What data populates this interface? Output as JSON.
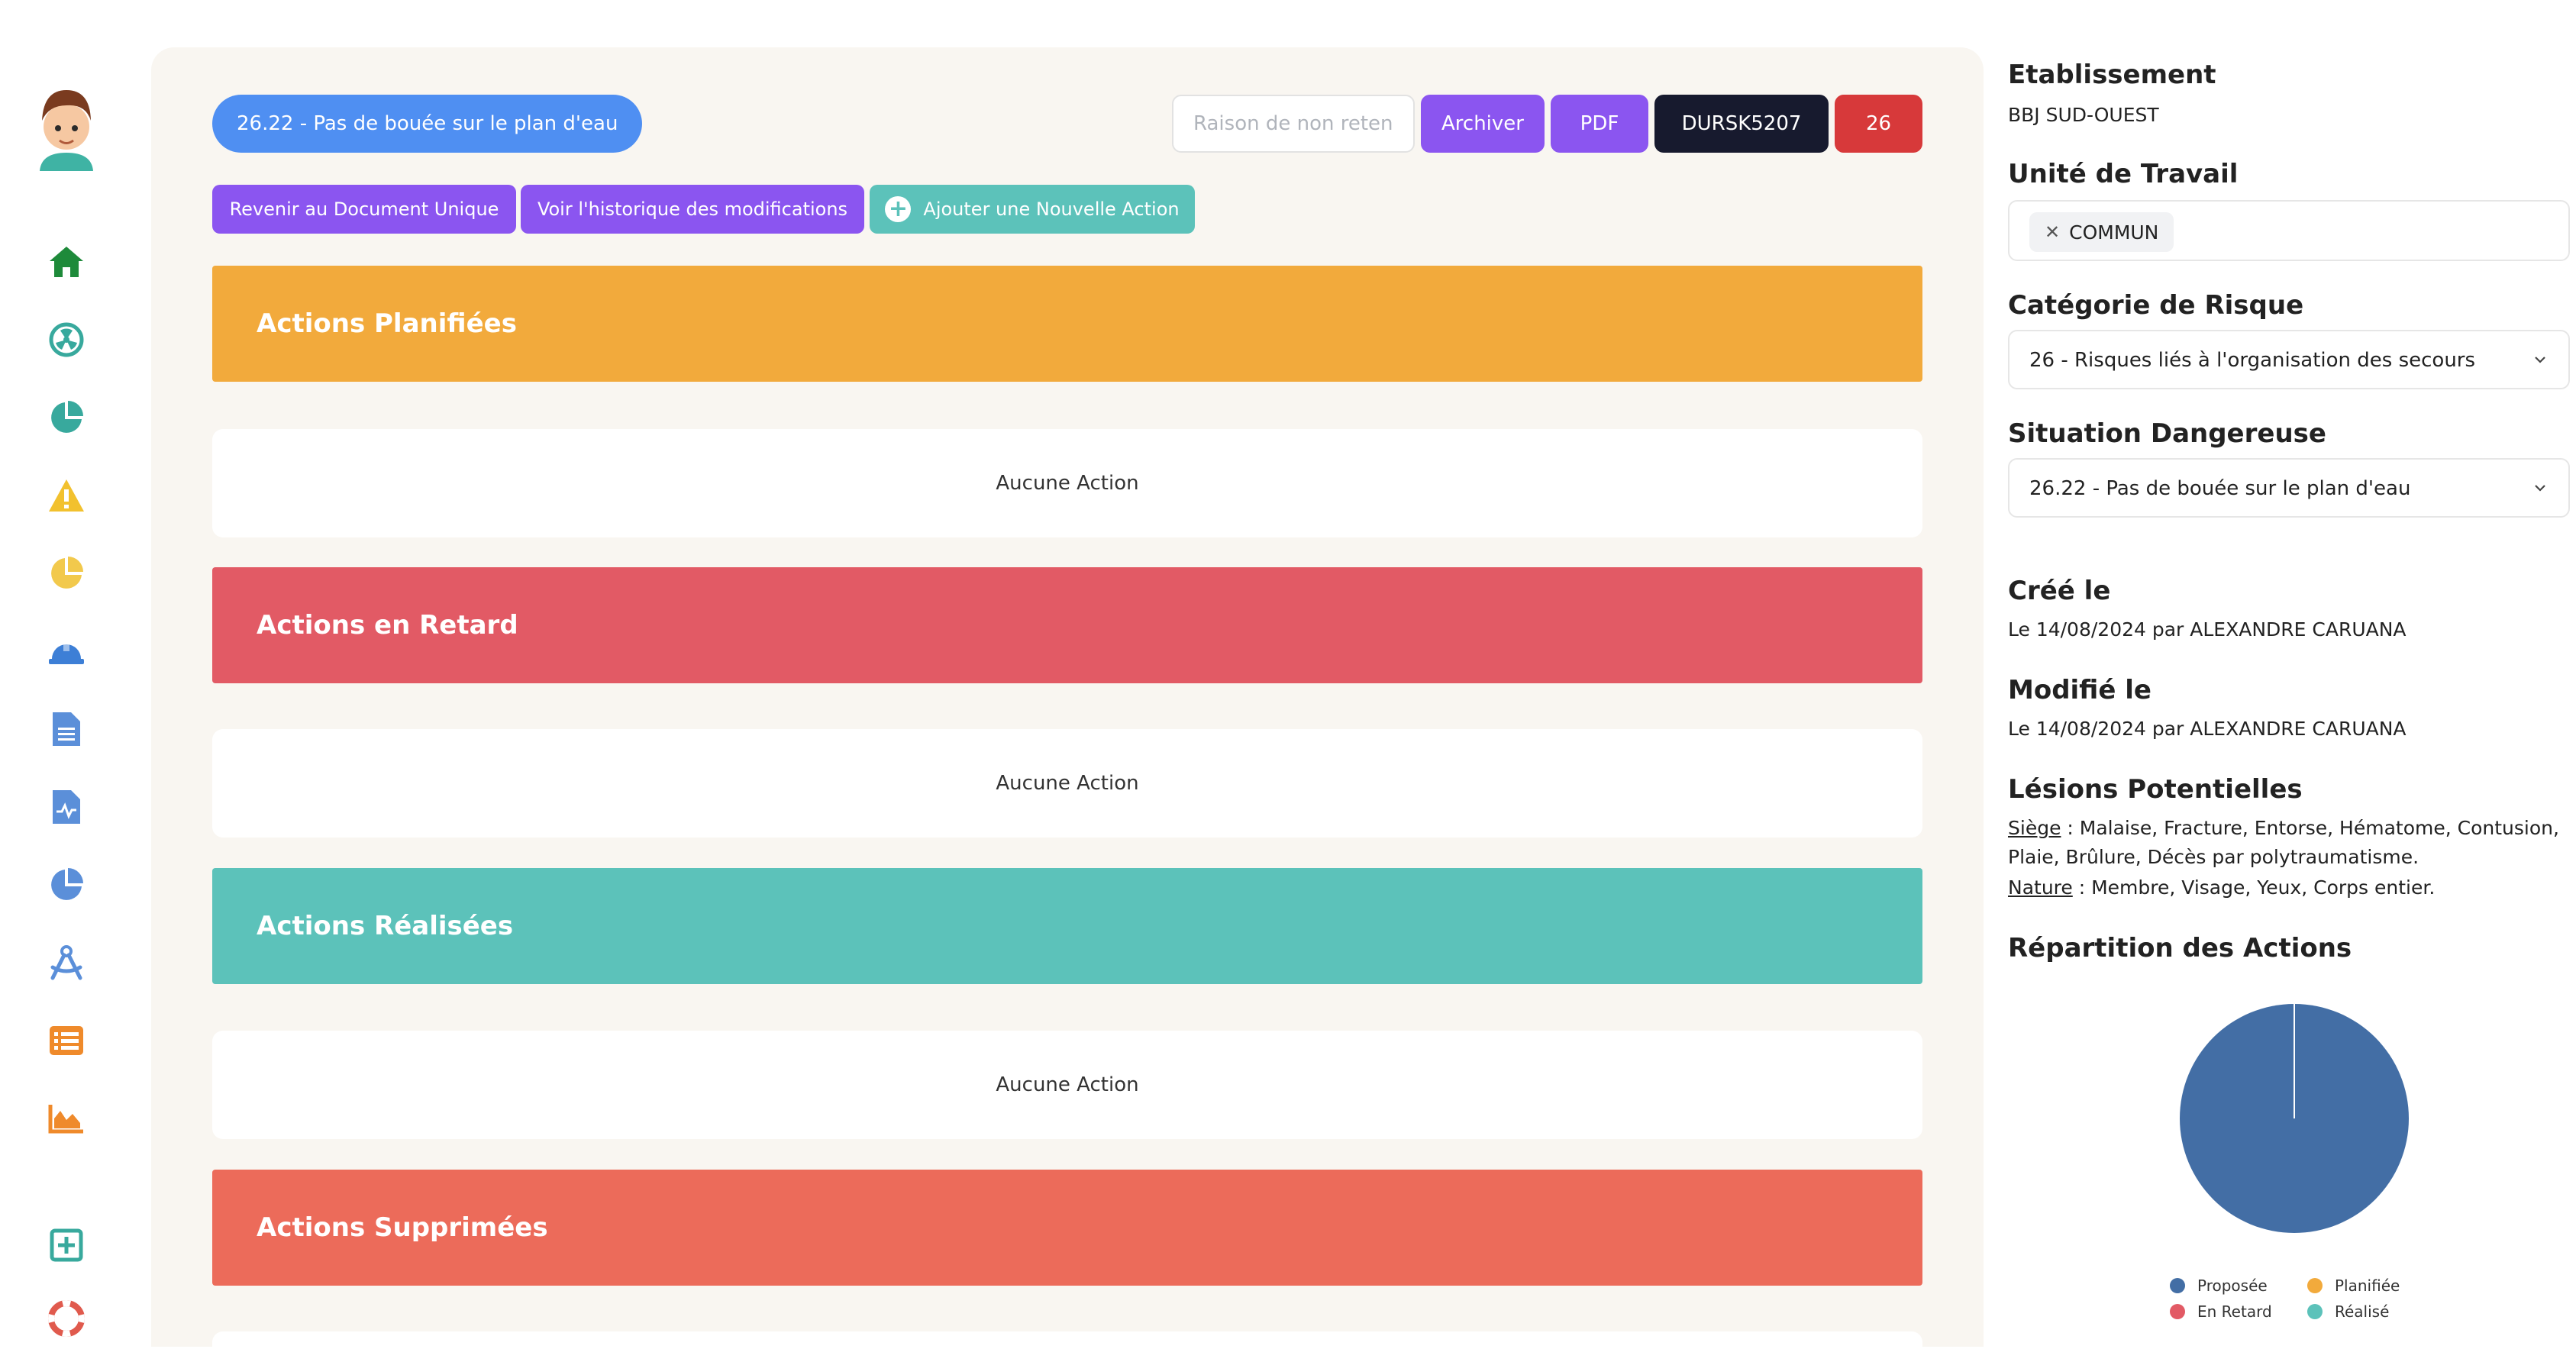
{
  "sidebar": {
    "icons": [
      "home-icon",
      "radiation-icon",
      "pie-chart-icon",
      "warning-icon",
      "pie-chart-half-icon",
      "hard-hat-icon",
      "document-icon",
      "medical-file-icon",
      "pie-chart-blue-icon",
      "compass-icon",
      "list-icon",
      "area-chart-icon",
      "add-square-icon",
      "lifebuoy-icon"
    ]
  },
  "header": {
    "risk_title": "26.22 - Pas de bouée sur le plan d'eau",
    "reason_placeholder": "Raison de non retenu",
    "archive_label": "Archiver",
    "pdf_label": "PDF",
    "code_label": "DURSK5207",
    "number_label": "26"
  },
  "actions_bar": {
    "back_label": "Revenir au Document Unique",
    "history_label": "Voir l'historique des modifications",
    "add_label": "Ajouter une Nouvelle Action"
  },
  "sections": [
    {
      "title": "Actions Planifiées",
      "empty": "Aucune Action",
      "color": "#f2aa3c"
    },
    {
      "title": "Actions en Retard",
      "empty": "Aucune Action",
      "color": "#e25a65"
    },
    {
      "title": "Actions Réalisées",
      "empty": "Aucune Action",
      "color": "#5cc2ba"
    },
    {
      "title": "Actions Supprimées",
      "color": "#ec6b5a"
    }
  ],
  "details": {
    "etablissement_label": "Etablissement",
    "etablissement_value": "BBJ SUD-OUEST",
    "unite_label": "Unité de Travail",
    "unite_chip": "COMMUN",
    "categorie_label": "Catégorie de Risque",
    "categorie_value": "26 - Risques liés à l'organisation des secours",
    "situation_label": "Situation Dangereuse",
    "situation_value": "26.22 - Pas de bouée sur le plan d'eau",
    "cree_label": "Créé le",
    "cree_value": "Le 14/08/2024 par ALEXANDRE CARUANA",
    "modifie_label": "Modifié le",
    "modifie_value": "Le 14/08/2024 par ALEXANDRE CARUANA",
    "lesions_label": "Lésions Potentielles",
    "siege_label": "Siège",
    "siege_value": " : Malaise, Fracture, Entorse, Hématome, Contusion,",
    "siege_value_2": "Plaie, Brûlure, Décès par polytraumatisme.",
    "nature_label": "Nature",
    "nature_value": " : Membre, Visage, Yeux, Corps entier.",
    "repartition_label": "Répartition des Actions"
  },
  "chart_data": {
    "type": "pie",
    "categories": [
      "Proposée",
      "Planifiée",
      "En Retard",
      "Réalisé"
    ],
    "values": [
      1,
      0,
      0,
      0
    ],
    "colors": [
      "#436ea5",
      "#f2aa3c",
      "#e25a65",
      "#5cc2ba"
    ],
    "legend": "bottom"
  },
  "colors": {
    "purple": "#8b55f0",
    "dark": "#171a2e",
    "red": "#d7393a",
    "blue": "#4f8ff2",
    "teal": "#5cc2ba"
  }
}
